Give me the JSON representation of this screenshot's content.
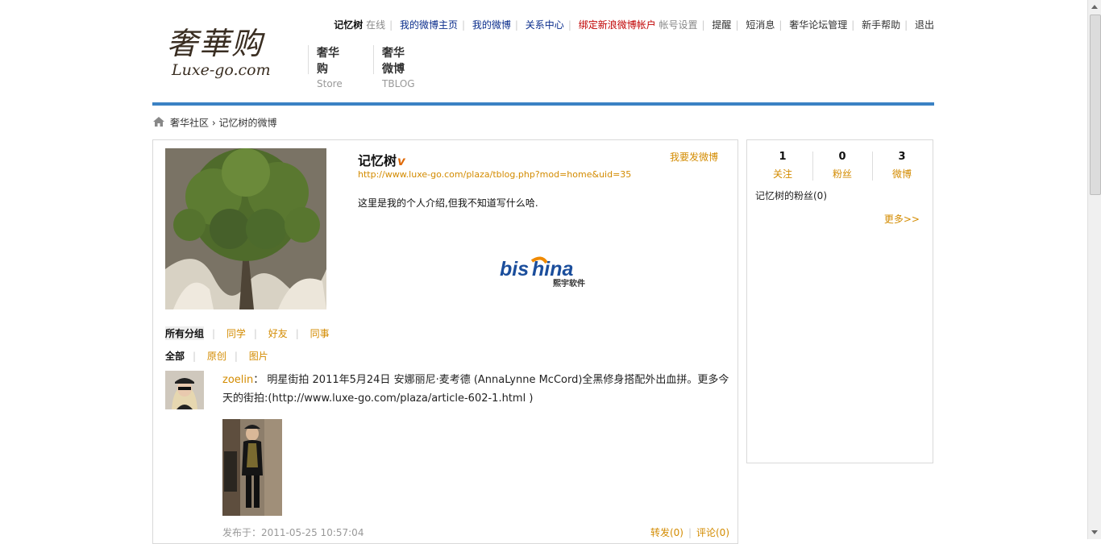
{
  "topnav": {
    "user": "记忆树",
    "status": "在线",
    "items": [
      "我的微博主页",
      "我的微博",
      "关系中心",
      "绑定新浪微博帐户",
      "帐号设置",
      "提醒",
      "短消息",
      "奢华论坛管理",
      "新手帮助",
      "退出"
    ]
  },
  "logo": {
    "cn": "奢華购",
    "en": "Luxe-go.com"
  },
  "mainnav": [
    {
      "title": "奢华购",
      "sub": "Store"
    },
    {
      "title": "奢华微博",
      "sub": "TBLOG"
    }
  ],
  "breadcrumb": {
    "home": "奢华社区",
    "sep": "›",
    "current": "记忆树的微博"
  },
  "profile": {
    "name": "记忆树",
    "verified_mark": "v",
    "post_button": "我要发微博",
    "url": "http://www.luxe-go.com/plaza/tblog.php?mod=home&uid=35",
    "intro": "这里是我的个人介绍,但我不知道写什么哈."
  },
  "ad": {
    "brand": "bisChina",
    "sub": "熙宇软件"
  },
  "groups": [
    "所有分组",
    "同学",
    "好友",
    "同事"
  ],
  "tabs": [
    "全部",
    "原创",
    "图片"
  ],
  "feed": [
    {
      "author": "zoelin",
      "colon": "：",
      "text": "明星街拍 2011年5月24日 安娜丽尼·麦考德 (AnnaLynne McCord)全黑修身搭配外出血拼。更多今天的街拍:(http://www.luxe-go.com/plaza/article-602-1.html )",
      "time": "发布于：2011-05-25 10:57:04",
      "forward": "转发(0)",
      "comment": "评论(0)"
    }
  ],
  "sidebar": {
    "stats": [
      {
        "num": "1",
        "label": "关注"
      },
      {
        "num": "0",
        "label": "粉丝"
      },
      {
        "num": "3",
        "label": "微博"
      }
    ],
    "fans_title": "记忆树的粉丝(0)",
    "more": "更多>>"
  },
  "colors": {
    "accent": "#3b82c4",
    "link_orange": "#d38b00",
    "nav_blue": "#0a2d8c",
    "nav_red": "#c00000"
  }
}
